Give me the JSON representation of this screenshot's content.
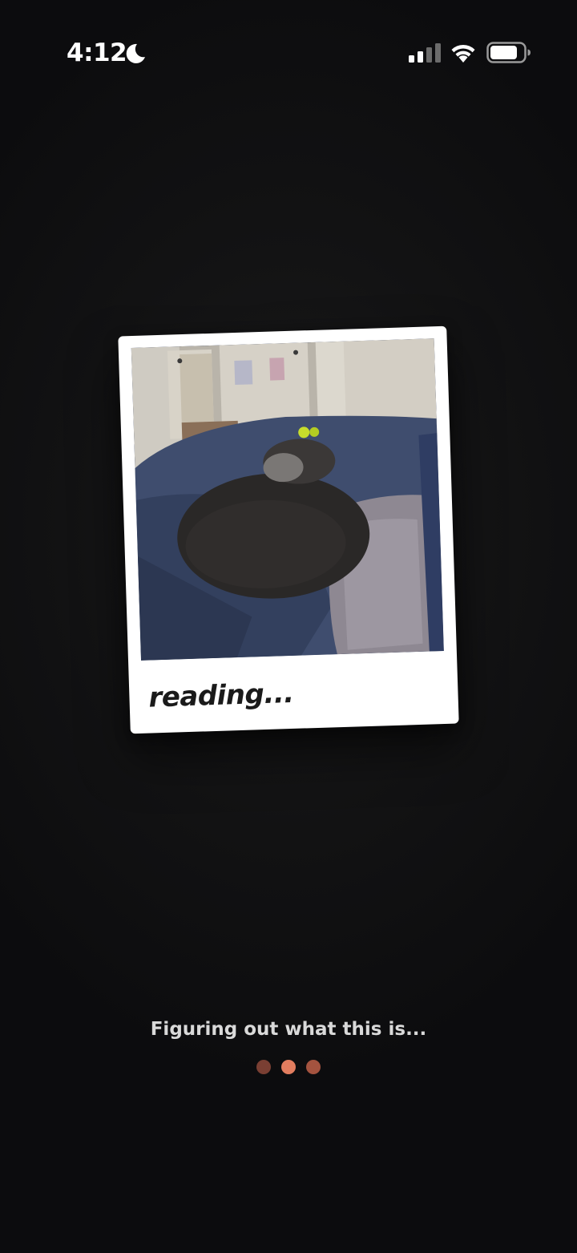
{
  "status_bar": {
    "time": "4:12",
    "icons": [
      "moon-icon",
      "signal-icon",
      "wifi-icon",
      "battery-icon"
    ]
  },
  "polaroid": {
    "photo_description_icon": "photo-thumbnail",
    "caption": "reading..."
  },
  "status": {
    "message": "Figuring out what this is...",
    "loading_dots": [
      {
        "name": "dot-1",
        "color": "#7a3f33"
      },
      {
        "name": "dot-2",
        "color": "#e27d5f"
      },
      {
        "name": "dot-3",
        "color": "#a4533f"
      }
    ]
  },
  "colors": {
    "background": "#121213",
    "accent": "#e27d5f",
    "card": "#ffffff",
    "text_dim": "#d9d9d9"
  }
}
